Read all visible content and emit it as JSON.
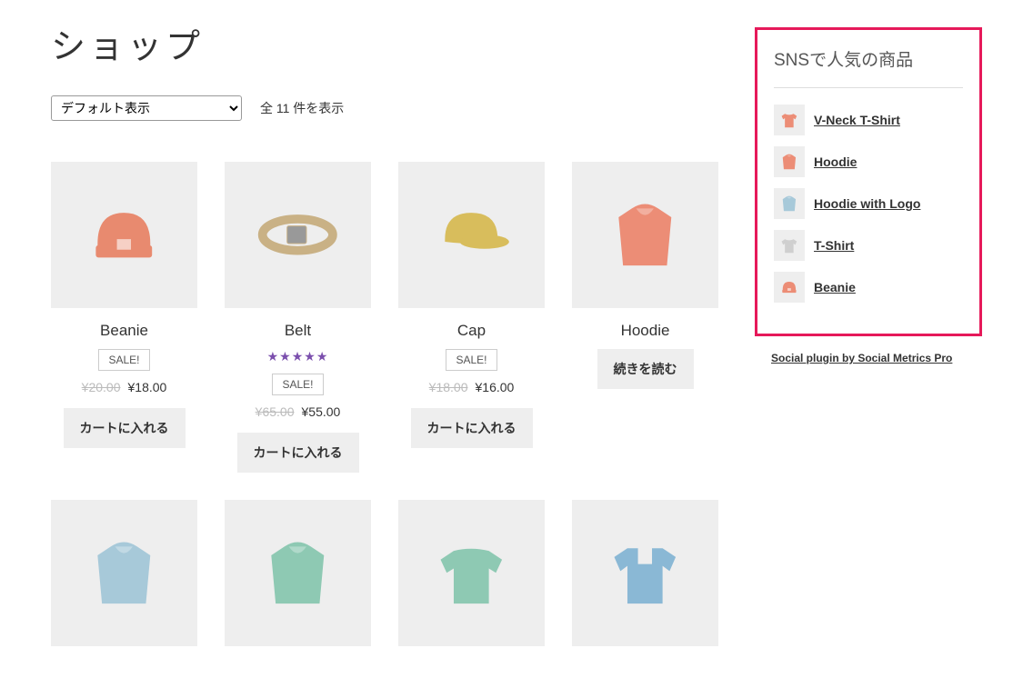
{
  "page_title": "ショップ",
  "sort": {
    "selected": "デフォルト表示"
  },
  "result_count": "全 11 件を表示",
  "labels": {
    "add_to_cart": "カートに入れる",
    "read_more": "続きを読む",
    "sale": "SALE!"
  },
  "products": [
    {
      "name": "Beanie",
      "sale": true,
      "old_price": "¥20.00",
      "price": "¥18.00",
      "button": "cart",
      "icon": "beanie",
      "color": "#e88a6f",
      "rating": null
    },
    {
      "name": "Belt",
      "sale": true,
      "old_price": "¥65.00",
      "price": "¥55.00",
      "button": "cart",
      "icon": "belt",
      "color": "#c9b185",
      "rating": 5
    },
    {
      "name": "Cap",
      "sale": true,
      "old_price": "¥18.00",
      "price": "¥16.00",
      "button": "cart",
      "icon": "cap",
      "color": "#d8bd5c",
      "rating": null
    },
    {
      "name": "Hoodie",
      "sale": false,
      "old_price": null,
      "price": null,
      "button": "read",
      "icon": "hoodie",
      "color": "#ec8d76",
      "rating": null
    },
    {
      "name": "",
      "sale": false,
      "old_price": null,
      "price": null,
      "button": null,
      "icon": "hoodie",
      "color": "#a7c9d9",
      "rating": null
    },
    {
      "name": "",
      "sale": false,
      "old_price": null,
      "price": null,
      "button": null,
      "icon": "hoodie",
      "color": "#8ec9b3",
      "rating": null
    },
    {
      "name": "",
      "sale": false,
      "old_price": null,
      "price": null,
      "button": null,
      "icon": "sweater",
      "color": "#8ec9b3",
      "rating": null
    },
    {
      "name": "",
      "sale": false,
      "old_price": null,
      "price": null,
      "button": null,
      "icon": "polo",
      "color": "#8ab8d5",
      "rating": null
    }
  ],
  "sidebar": {
    "popular_title": "SNSで人気の商品",
    "popular_items": [
      {
        "label": "V-Neck T-Shirt",
        "icon": "tshirt",
        "color": "#ec8d76"
      },
      {
        "label": "Hoodie",
        "icon": "hoodie",
        "color": "#ec8d76"
      },
      {
        "label": "Hoodie with Logo",
        "icon": "hoodie",
        "color": "#a7c9d9"
      },
      {
        "label": "T-Shirt",
        "icon": "tshirt",
        "color": "#cfcfcf"
      },
      {
        "label": "Beanie",
        "icon": "beanie",
        "color": "#ec8d76"
      }
    ],
    "credit": "Social plugin by Social Metrics Pro"
  }
}
